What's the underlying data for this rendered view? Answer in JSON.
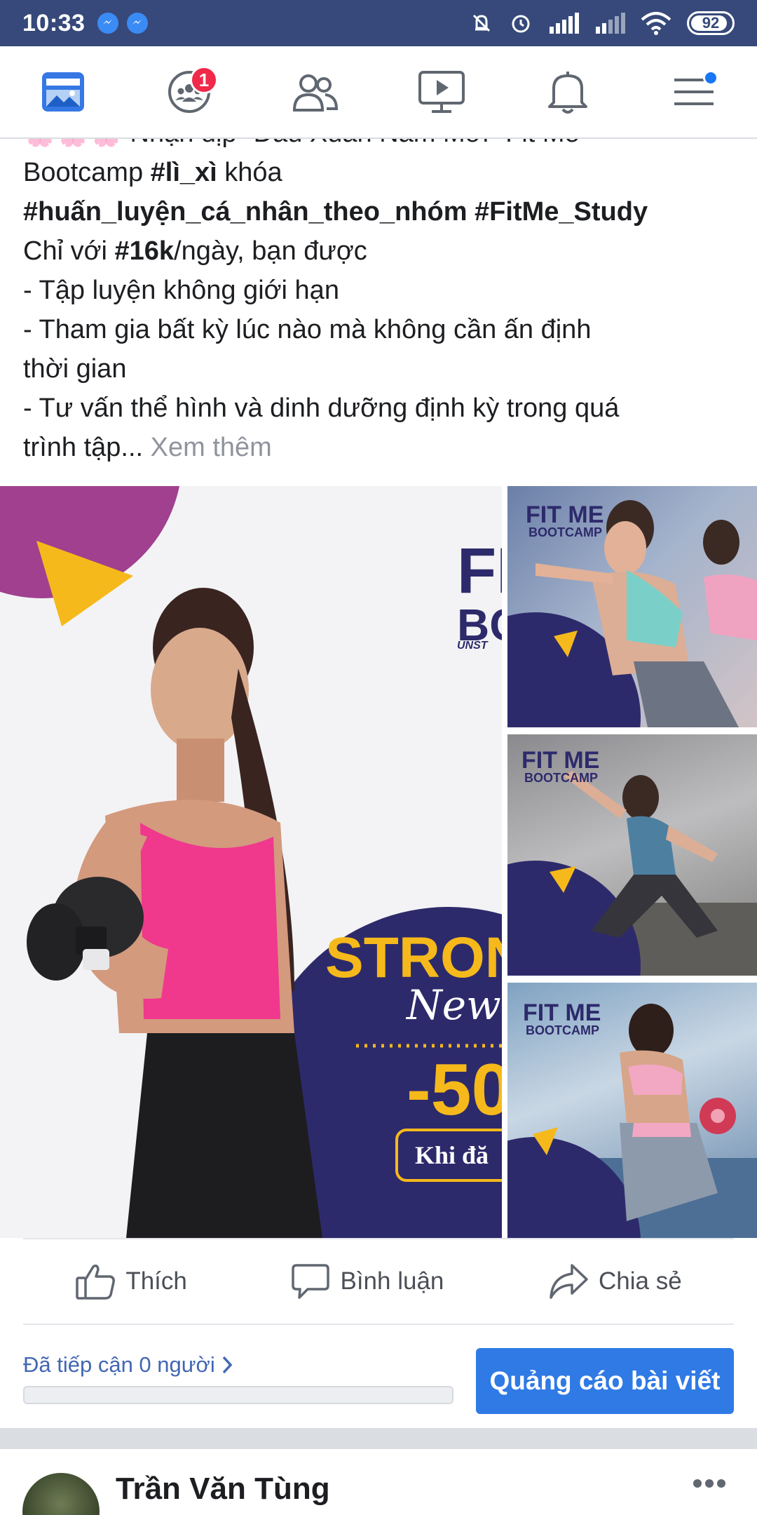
{
  "status_bar": {
    "time": "10:33",
    "battery": "92",
    "battery_level": 0.92
  },
  "nav": {
    "items": [
      {
        "name": "news-feed",
        "icon": "news-feed-icon",
        "active": true
      },
      {
        "name": "groups",
        "icon": "groups-icon",
        "badge": "1"
      },
      {
        "name": "friends",
        "icon": "friends-icon"
      },
      {
        "name": "watch",
        "icon": "video-icon"
      },
      {
        "name": "notifications",
        "icon": "bell-icon"
      },
      {
        "name": "menu",
        "icon": "hamburger-menu-icon",
        "dot": true
      }
    ],
    "accent": "#1877f2",
    "badge_color": "#f02849"
  },
  "post": {
    "line0": "🌸🌸🌸 Nhận dịp \"Đầu Xuân Năm Mới\" Fit Me",
    "line1_a": "Bootcamp ",
    "line1_b": "#lì_xì",
    "line1_c": " khóa",
    "line2": "#huấn_luyện_cá_nhân_theo_nhóm #FitMe_Study",
    "line3_a": "Chỉ với ",
    "line3_b": "#16k",
    "line3_c": "/ngày, bạn được",
    "line4": "- Tập luyện không giới hạn",
    "line5": "- Tham gia bất kỳ lúc nào mà không cần ấn định",
    "line6": "thời gian",
    "line7": "- Tư vấn thể hình và dinh dưỡng định kỳ trong quá",
    "line8": "trình tập...",
    "see_more": " Xem thêm"
  },
  "photos": {
    "main": {
      "brand_top": "FI",
      "brand_mid": "BC",
      "brand_sub": "UNST",
      "headline": "STRONG",
      "script": "New",
      "discount": "-50",
      "pill": "Khi đă"
    },
    "side_brand": "FIT ME",
    "side_sub": "BOOTCAMP",
    "purple": "#2d2a6b",
    "yellow": "#f6b91b",
    "magenta": "#a0408f"
  },
  "actions": {
    "like": "Thích",
    "comment": "Bình luận",
    "share": "Chia sẻ"
  },
  "reach": {
    "text": "Đã tiếp cận 0 người",
    "progress": 0,
    "promote": "Quảng cáo bài viết"
  },
  "next_post": {
    "author": "Trần Văn Tùng"
  }
}
